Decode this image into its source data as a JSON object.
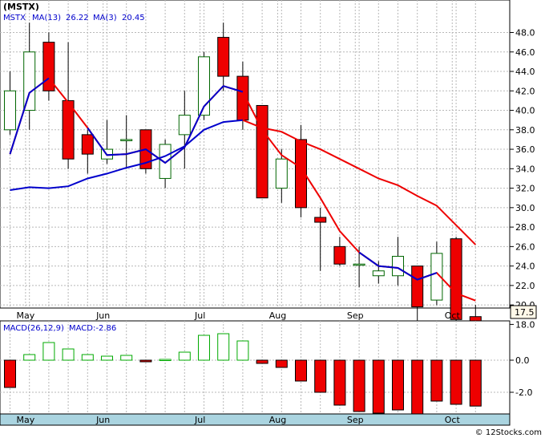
{
  "chart_data": [
    {
      "type": "candlestick",
      "symbol_label": "(MSTX)",
      "legend": [
        {
          "label": "MSTX",
          "color": "#0000cc"
        },
        {
          "label": "MA(13)",
          "value": "26.22",
          "color": "#ee0000"
        },
        {
          "label": "MA(3)",
          "value": "20.45",
          "color": "#0000cc"
        }
      ],
      "y_ticks": [
        18,
        20,
        22,
        24,
        26,
        28,
        30,
        32,
        34,
        36,
        38,
        40,
        42,
        44,
        46,
        48
      ],
      "y_tick_labels": [
        "18.0",
        "20.0",
        "22.0",
        "24.0",
        "26.0",
        "28.0",
        "30.0",
        "32.0",
        "34.0",
        "36.0",
        "38.0",
        "40.0",
        "42.0",
        "44.0",
        "46.0",
        "48.0"
      ],
      "last_price_label": "17.5",
      "x_months": [
        {
          "label": "May",
          "week": 0.8
        },
        {
          "label": "Jun",
          "week": 4.8
        },
        {
          "label": "Jul",
          "week": 9.8
        },
        {
          "label": "Aug",
          "week": 13.8
        },
        {
          "label": "Sep",
          "week": 17.8
        },
        {
          "label": "Oct",
          "week": 22.8
        }
      ],
      "candles": [
        {
          "o": 38,
          "h": 44,
          "l": 37.5,
          "c": 42
        },
        {
          "o": 40,
          "h": 49,
          "l": 38,
          "c": 46
        },
        {
          "o": 47,
          "h": 48,
          "l": 41,
          "c": 42
        },
        {
          "o": 41,
          "h": 47,
          "l": 34,
          "c": 35
        },
        {
          "o": 37.5,
          "h": 38,
          "l": 33.5,
          "c": 35.5
        },
        {
          "o": 35,
          "h": 39,
          "l": 34.5,
          "c": 36
        },
        {
          "o": 37,
          "h": 39.5,
          "l": 34,
          "c": 37
        },
        {
          "o": 38,
          "h": 38,
          "l": 33.5,
          "c": 34
        },
        {
          "o": 33,
          "h": 37,
          "l": 32,
          "c": 36.5
        },
        {
          "o": 37.5,
          "h": 42,
          "l": 34,
          "c": 39.5
        },
        {
          "o": 39.5,
          "h": 46,
          "l": 39,
          "c": 45.5
        },
        {
          "o": 47.5,
          "h": 49,
          "l": 42,
          "c": 43.5
        },
        {
          "o": 43.5,
          "h": 45,
          "l": 38,
          "c": 39
        },
        {
          "o": 40.5,
          "h": 40.5,
          "l": 31,
          "c": 31
        },
        {
          "o": 32,
          "h": 36,
          "l": 30.5,
          "c": 35
        },
        {
          "o": 37,
          "h": 38.5,
          "l": 29,
          "c": 30
        },
        {
          "o": 29,
          "h": 30,
          "l": 23.5,
          "c": 28.5
        },
        {
          "o": 26,
          "h": 27,
          "l": 24,
          "c": 24.2
        },
        {
          "o": 24.2,
          "h": 26,
          "l": 21.8,
          "c": 24.2
        },
        {
          "o": 23,
          "h": 24.5,
          "l": 22.2,
          "c": 23.5
        },
        {
          "o": 23,
          "h": 27,
          "l": 22,
          "c": 25
        },
        {
          "o": 24,
          "h": 24,
          "l": 17.5,
          "c": 19.8
        },
        {
          "o": 20.5,
          "h": 26.5,
          "l": 20,
          "c": 25.3
        },
        {
          "o": 26.8,
          "h": 27,
          "l": 18.3,
          "c": 18.5
        },
        {
          "o": 18.8,
          "h": 20,
          "l": 17.3,
          "c": 17.5
        }
      ],
      "ma13_points": [
        [
          0,
          31.8
        ],
        [
          1,
          32.1
        ],
        [
          2,
          32.0
        ],
        [
          3,
          32.2
        ],
        [
          4,
          33.0
        ],
        [
          5,
          33.5
        ],
        [
          6,
          34.1
        ],
        [
          7,
          34.6
        ],
        [
          8,
          35.3
        ],
        [
          9,
          36.3
        ],
        [
          10,
          38.0
        ],
        [
          11,
          38.8
        ],
        [
          12,
          39.0
        ],
        [
          13,
          38.2
        ],
        [
          14,
          37.8
        ],
        [
          15,
          36.8
        ],
        [
          16,
          36.0
        ],
        [
          17,
          35.0
        ],
        [
          18,
          34.0
        ],
        [
          19,
          33.0
        ],
        [
          20,
          32.3
        ],
        [
          21,
          31.2
        ],
        [
          22,
          30.2
        ],
        [
          23,
          28.2
        ],
        [
          24,
          26.2
        ]
      ],
      "ma3_points": [
        [
          0,
          35.5
        ],
        [
          1,
          41.8
        ],
        [
          2,
          43.3
        ],
        [
          3,
          40.8
        ],
        [
          4,
          38.2
        ],
        [
          5,
          35.4
        ],
        [
          6,
          35.5
        ],
        [
          7,
          36.0
        ],
        [
          8,
          34.6
        ],
        [
          9,
          36.2
        ],
        [
          10,
          40.4
        ],
        [
          11,
          42.5
        ],
        [
          12,
          41.9
        ],
        [
          13,
          38.0
        ],
        [
          14,
          35.4
        ],
        [
          15,
          34.1
        ],
        [
          16,
          31.0
        ],
        [
          17,
          27.6
        ],
        [
          18,
          25.4
        ],
        [
          19,
          24.0
        ],
        [
          20,
          23.8
        ],
        [
          21,
          22.6
        ],
        [
          22,
          23.3
        ],
        [
          23,
          21.2
        ],
        [
          24,
          20.45
        ]
      ],
      "ma3_blue_ranges": [
        [
          0,
          2
        ],
        [
          4,
          12
        ],
        [
          18,
          22
        ]
      ]
    },
    {
      "type": "bar",
      "title_label": "MACD(26,12,9)",
      "value_label": "MACD:-2.86",
      "y_ticks": [
        -2,
        0
      ],
      "y_tick_labels": [
        "-2.0",
        "0.0"
      ],
      "x_months": [
        "May",
        "Jun",
        "Jul",
        "Aug",
        "Sep",
        "Oct"
      ],
      "values": [
        -1.7,
        0.35,
        1.1,
        0.7,
        0.35,
        0.25,
        0.3,
        -0.1,
        0.05,
        0.5,
        1.55,
        1.65,
        1.2,
        -0.2,
        -0.45,
        -1.3,
        -2.0,
        -2.8,
        -3.2,
        -3.3,
        -3.1,
        -3.4,
        -2.55,
        -2.75,
        -2.86
      ],
      "positive_color": "#00aa00",
      "negative_color": "#ee0000"
    }
  ],
  "credit": "© 12Stocks.com"
}
